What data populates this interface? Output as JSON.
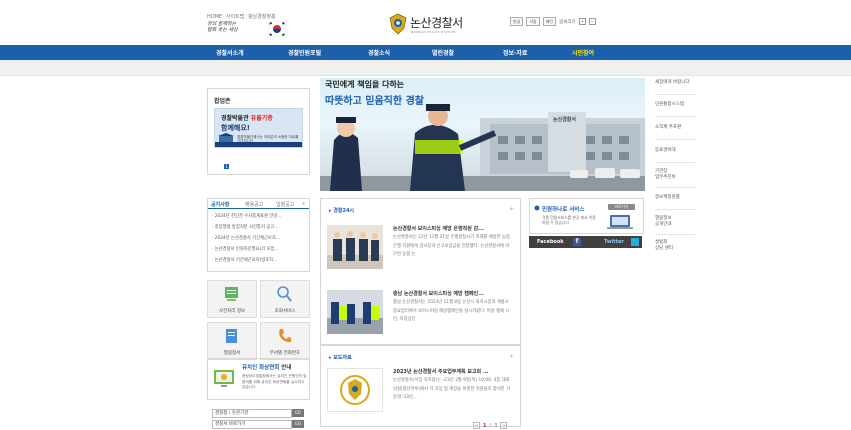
{
  "header": {
    "util_links": [
      "HOME",
      "사이트맵",
      "충남경찰청홈"
    ],
    "slogan": "정의 함께하는 평화 웃는 세상",
    "logo": {
      "name": "논산경찰서",
      "eng": "NONSAN POLICE STATION"
    },
    "tools": {
      "sel1": "한글",
      "sel2": "사람",
      "sel3": "패턴",
      "print": "글씨크기"
    }
  },
  "nav": {
    "items": [
      "경찰서소개",
      "경찰민원포털",
      "경찰소식",
      "열린경찰",
      "정보·자료",
      "시민참여"
    ]
  },
  "popup": {
    "title": "팝업존",
    "banner_line1_pre": "경찰박물관 ",
    "banner_line1_em": "유물기증",
    "banner_line2": "함께해요!",
    "banner_line3": "경찰박물관에서는 여러분의 소중한 자료를 기다립니다",
    "page": "1"
  },
  "notice": {
    "tabs": [
      "공지사항",
      "채용공고",
      "입찰공고"
    ],
    "plus": "+",
    "items": [
      "2024년 친인친 수사통계표원 안녕...",
      "중앙행정 방침처분 사전통지 공고...",
      "2024년 논산경찰서 기간제근로자...",
      "논산경찰서 인원자문필요(리 모집...",
      "논산경찰서 기간제근로자(방호직..."
    ]
  },
  "quick": {
    "q1": "사건처리 정보",
    "q2": "조회서비스",
    "q3": "열람청서",
    "q4": "부서별 전화번호"
  },
  "victim": {
    "title_em": "유치인 ",
    "title_em2": "화상면회",
    "title_rest": " 안내",
    "desc": "충청남도경찰청에서는 유치인 민원인의 및 편의를 위해 유치인 화상면회를 실시하고 있습니다."
  },
  "selects": {
    "s1": "경찰청 / 유관기관",
    "s2": "경찰서 바로가기",
    "go": "GO"
  },
  "hero": {
    "line1": "국민에게 책임을 다하는",
    "line2": "따뜻하고 믿음직한 경찰",
    "sign": "논산경찰서"
  },
  "news": {
    "title": "경찰24시",
    "plus": "+",
    "articles": [
      {
        "headline": "논산경찰서 보이스피싱 예방 은행직원 감...",
        "body": "논산경찰서는 22년 11월 21일 은행원창사기 피해를 예방한 농협은행 직원에게 감사장과 신고보상금을 전달했다. 논산경찰서에 따르면 농협 논"
      },
      {
        "headline": "충남 논산경찰서 보이스피싱 예방 캠페인...",
        "body": "충남 논산경찰서는 2023년 11월 8일 논산시 화지시장과 계룡시 중요장터에서 보이스피싱 예방캠페인을 실시하였다. 이날 캠페 시민, 자장상인"
      }
    ]
  },
  "pr": {
    "title": "보도자료",
    "plus": "+",
    "headline": "2023년 논산경찰서 주요업무계획 보고회 ...",
    "body": "논산경찰서(서장 지치봉)는 ›23년 3월 9일(목) 10:00, 3층 대회의실(청산마루)에서 각 과장 및 계장을 비롯한 직원들이 참석한 가운데 '23년..."
  },
  "pager": {
    "prev": "<",
    "current": "1",
    "sep": "/",
    "total": "3",
    "next": ">"
  },
  "minwon": {
    "title": "민원하나로 서비스",
    "more": "바로가기",
    "desc": "각종 민원서비스를 한곳 에서 이용하실 수 있습니다."
  },
  "social": {
    "facebook": "Facebook",
    "twitter": "Twitter"
  },
  "right_links": [
    "새집에게 바랍니다",
    "민원통합시스템",
    "소직제 추포판",
    "동료경비대",
    "기관장\n업무추진비",
    "정보계정원활",
    "열람정보\n공개안내",
    "성범죄\n상담 센터"
  ],
  "colors": {
    "nav": "#1b5fad",
    "accent_red": "#d22222",
    "nav_active": "#ffe600"
  }
}
